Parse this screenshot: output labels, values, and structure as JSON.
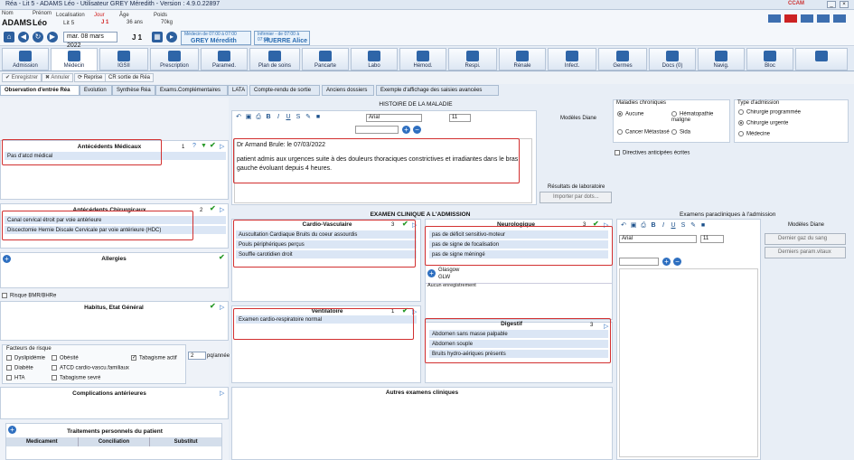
{
  "window": {
    "title": "Réa - Lit 5 - ADAMS Léo - Utilisateur GREY Méredith - Version : 4.9.0.22897"
  },
  "patient": {
    "nom_label": "Nom",
    "nom": "ADAMS",
    "prenom_label": "Prénom",
    "prenom": "Léo",
    "localisation_label": "Localisation",
    "localisation": "Lit 5",
    "jour_label": "Jour",
    "jour": "J 1",
    "age_label": "Âge",
    "age": "36 ans",
    "poids_label": "Poids",
    "poids": "70kg"
  },
  "nav": {
    "date": "mar. 08 mars 2022",
    "day": "J 1",
    "medecin_shift": "Médecin de 07:00 à 07:00",
    "medecin_name": "GREY Méredith",
    "infirmier_shift": "Infirmier - de 07:00 à 07:00",
    "infirmier_name": "HUERRE Alice"
  },
  "tabs": [
    "Admission",
    "Médecin",
    "IGSII",
    "Prescription",
    "Paramed.",
    "Plan de soins",
    "Pancarte",
    "Labo",
    "Hémod.",
    "Respi.",
    "Rénale",
    "Infect.",
    "Germes",
    "Docs (0)",
    "Navig.",
    "Bloc"
  ],
  "toolbar": {
    "save": "Enregistrer",
    "cancel": "Annuler",
    "reprise": "Reprise",
    "cr_sortie": "CR sortie de Réa"
  },
  "subtabs": [
    "Observation d'entrée Réa",
    "Evolution",
    "Synthèse Réa",
    "Exams.Complémentaires",
    "LATA",
    "Compte-rendu de sortie",
    "Anciens dossiers",
    "Exemple d'affichage des saisies avancées"
  ],
  "left": {
    "antecedents_medicaux": {
      "title": "Antécédents Médicaux",
      "count": "1",
      "items": [
        "Pas d'atcd médical"
      ]
    },
    "antecedents_chirurgicaux": {
      "title": "Antécédents Chirurgicaux",
      "count": "2",
      "items": [
        "Canal cervical étroit par voie antérieure",
        "Discectomie Hernie Discale Cervicale par voie antérieure (HDC)"
      ]
    },
    "allergies": {
      "title": "Allergies"
    },
    "risque": "Risque BMR/BHRe",
    "habitus": {
      "title": "Habitus, Etat Général"
    },
    "facteurs": {
      "title": "Facteurs de risque",
      "items": [
        "Dyslipidémie",
        "Obésité",
        "Tabagisme actif",
        "Diabète",
        "ATCD cardio-vascu.familiaux",
        "Tabagisme sevré",
        "HTA"
      ],
      "paquets_value": "2",
      "paquets_label": "pq/année"
    },
    "complications": {
      "title": "Complications antérieures"
    },
    "traitements": {
      "title": "Traitements personnels du patient",
      "cols": [
        "Medicament",
        "Conciliation",
        "Substitut"
      ]
    }
  },
  "histoire": {
    "title": "HISTOIRE DE LA MALADIE",
    "font": "Arial",
    "size": "11",
    "line1": "Dr Armand Brule: le 07/03/2022",
    "text": "patient admis aux urgences suite à des douleurs thoraciques constrictives et irradiantes dans le bras gauche évoluant depuis 4 heures."
  },
  "modeles_diane": "Modèles Diane",
  "maladies_chroniques": {
    "title": "Maladies chroniques",
    "options": [
      "Aucune",
      "Hématopathie maligne",
      "Cancer Métastasé",
      "Sida"
    ],
    "selected": "Aucune"
  },
  "type_admission": {
    "title": "Type d'admission",
    "options": [
      "Chirurgie programmée",
      "Chirurgie urgente",
      "Médecine"
    ],
    "selected": "Chirurgie urgente"
  },
  "directives": "Directives anticipées écrites",
  "labo": {
    "title": "Résultats de laboratoire",
    "button": "Importer par dots..."
  },
  "examen": {
    "title": "EXAMEN CLINIQUE A L'ADMISSION",
    "cardio": {
      "title": "Cardio-Vasculaire",
      "count": "3",
      "items": [
        "Auscultation Cardiaque Bruits du coeur assourdis",
        "Pouls périphériques perçus",
        "Souffle carotidien droit"
      ]
    },
    "neuro": {
      "title": "Neurologique",
      "count": "3",
      "items": [
        "pas de déficit sensitivo-moteur",
        "pas de signe de focalisation",
        "pas de signe méningé"
      ]
    },
    "glasgow": "Glasgow",
    "glw": "GLW",
    "aucun": "Aucun enregistrement",
    "ventil": {
      "title": "Ventilatoire",
      "count": "1",
      "items": [
        "Examen cardio-respiratoire normal"
      ]
    },
    "digestif": {
      "title": "Digestif",
      "count": "3",
      "items": [
        "Abdomen sans masse palpable",
        "Abdomen souple",
        "Bruits hydro-aériques présents"
      ]
    },
    "autres": "Autres examens cliniques"
  },
  "paraclinique": {
    "title": "Examens paracliniques à l'admission",
    "font": "Arial",
    "size": "11",
    "modeles": "Modèles Diane",
    "btn1": "Dernier gaz du sang",
    "btn2": "Derniers param.vitaux"
  }
}
